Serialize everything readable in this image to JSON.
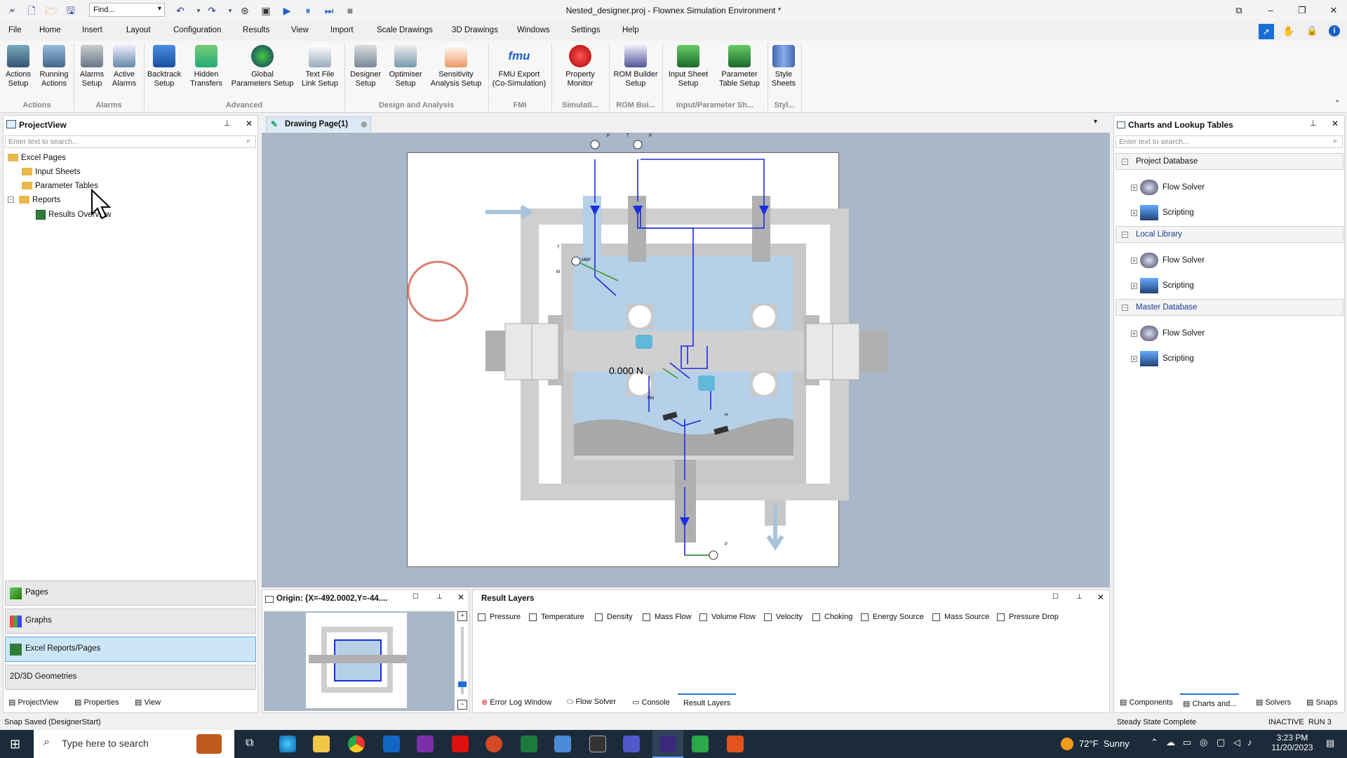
{
  "app": {
    "title": "Nested_designer.proj - Flownex Simulation Environment *",
    "find_placeholder": "Find..."
  },
  "menu": [
    "File",
    "Home",
    "Insert",
    "Layout",
    "Configuration",
    "Results",
    "View",
    "Import",
    "Scale Drawings",
    "3D Drawings",
    "Windows",
    "Settings",
    "Help"
  ],
  "ribbon": {
    "buttons": [
      {
        "l1": "Actions",
        "l2": "Setup"
      },
      {
        "l1": "Running",
        "l2": "Actions"
      },
      {
        "l1": "Alarms",
        "l2": "Setup"
      },
      {
        "l1": "Active",
        "l2": "Alarms"
      },
      {
        "l1": "Backtrack",
        "l2": "Setup"
      },
      {
        "l1": "Hidden",
        "l2": "Transfers"
      },
      {
        "l1": "Global",
        "l2": "Parameters Setup"
      },
      {
        "l1": "Text File",
        "l2": "Link Setup"
      },
      {
        "l1": "Designer",
        "l2": "Setup"
      },
      {
        "l1": "Optimiser",
        "l2": "Setup"
      },
      {
        "l1": "Sensitivity",
        "l2": "Analysis Setup"
      },
      {
        "l1": "FMU Export",
        "l2": "(Co-Simulation)"
      },
      {
        "l1": "Property",
        "l2": "Monitor"
      },
      {
        "l1": "ROM Builder",
        "l2": "Setup"
      },
      {
        "l1": "Input Sheet",
        "l2": "Setup"
      },
      {
        "l1": "Parameter",
        "l2": "Table Setup"
      },
      {
        "l1": "Style",
        "l2": "Sheets"
      }
    ],
    "groups": [
      "Actions",
      "Alarms",
      "Advanced",
      "Design and Analysis",
      "FMI",
      "Simulati...",
      "ROM Bui...",
      "Input/Parameter Sh...",
      "Styl..."
    ],
    "fmu_icon_text": "fmu"
  },
  "project_view": {
    "title": "ProjectView",
    "search_placeholder": "Enter text to search...",
    "tree": {
      "excel_pages": "Excel Pages",
      "input_sheets": "Input Sheets",
      "parameter_tables": "Parameter Tables",
      "reports": "Reports",
      "results_overview": "Results Overview"
    },
    "nav": {
      "pages": "Pages",
      "graphs": "Graphs",
      "excel": "Excel Reports/Pages",
      "geom": "2D/3D Geometries"
    },
    "bottom_tabs": {
      "projectview": "ProjectView",
      "properties": "Properties",
      "view": "View"
    }
  },
  "drawing": {
    "tab_label": "Drawing Page(1)",
    "force_label": "0.000 N",
    "labels": {
      "p1": "P",
      "t1": "T",
      "p2": "P",
      "t2": "T",
      "m": "M",
      "mbp": "MBP",
      "pm": "PM",
      "h": "H",
      "p3": "P"
    }
  },
  "overview": {
    "origin_label": "Origin: {X=-492.0002,Y=-44...."
  },
  "result_layers": {
    "title": "Result Layers",
    "items": [
      "Pressure",
      "Temperature",
      "Density",
      "Mass Flow",
      "Volume Flow",
      "Velocity",
      "Choking",
      "Energy Source",
      "Mass Source",
      "Pressure Drop"
    ],
    "bottom_tabs": {
      "error": "Error Log Window",
      "flow": "Flow Solver",
      "console": "Console",
      "layers": "Result Layers"
    }
  },
  "charts": {
    "title": "Charts and Lookup Tables",
    "search_placeholder": "Enter text to search...",
    "project_db": "Project Database",
    "local_lib": "Local Library",
    "master_db": "Master Database",
    "flow_solver": "Flow Solver",
    "scripting": "Scripting",
    "bottom_tabs": {
      "components": "Components",
      "charts": "Charts and...",
      "solvers": "Solvers",
      "snaps": "Snaps"
    }
  },
  "status": {
    "left": "Snap Saved (DesignerStart)",
    "center": "Steady State Complete",
    "right": "INACTIVE  RUN 3"
  },
  "taskbar": {
    "search": "Type here to search",
    "weather": "72°F  Sunny",
    "time": "3:23 PM",
    "date": "11/20/2023"
  }
}
